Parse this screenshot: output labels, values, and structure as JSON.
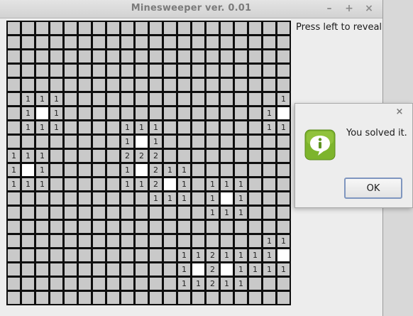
{
  "window": {
    "title": "Minesweeper ver. 0.01",
    "minimize_label": "–",
    "maximize_label": "+",
    "close_label": "×",
    "status_text": "Press left to reveal"
  },
  "board": {
    "rows": 20,
    "cols": 20,
    "cells": [
      "....................",
      "....................",
      "....................",
      "....................",
      "....................",
      ".111...............1",
      ".1 1..............1 ",
      ".111....111.......11",
      "........1 1.........",
      "111.....222.........",
      "1 1.....1 211.......",
      "111.....112 1.111...",
      "..........111.1 1...",
      "..............111...",
      "....................",
      "..................11",
      "............1121111 ",
      "............1 2 1111",
      "............11211...",
      "...................."
    ]
  },
  "dialog": {
    "message": "You solved it.",
    "ok_label": "OK",
    "close_label": "×",
    "icon": "info-icon"
  },
  "colors": {
    "unrevealed": "#c9c9c9",
    "revealed_empty": "#ffffff",
    "grid_lines": "#0e0e0e",
    "icon_green": "#7db42c"
  }
}
